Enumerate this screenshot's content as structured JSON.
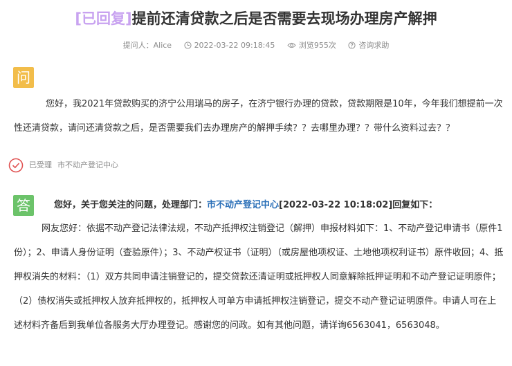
{
  "header": {
    "status": "[已回复]",
    "title": "提前还清贷款之后是否需要去现场办理房产解押"
  },
  "meta": {
    "asker_label": "提问人：",
    "asker": "Alice",
    "time": "2022-03-22 09:18:45",
    "views": "浏览955次",
    "category": "咨询求助"
  },
  "question": {
    "badge": "问",
    "text": "您好，我2021年贷款购买的济宁公用瑞马的房子，在济宁银行办理的贷款，贷款期限是10年，今年我们想提前一次性还清贷款，请问还清贷款之后，是否需要我们去办理房产的解押手续？？去哪里办理？？带什么资料过去？？"
  },
  "status": {
    "accepted": "已受理",
    "department": "市不动产登记中心"
  },
  "answer": {
    "badge": "答",
    "head_prefix": "您好，关于您关注的问题，处理部门：",
    "head_dept": "市不动产登记中心",
    "head_suffix": "[2022-03-22 10:18:02]回复如下：",
    "text": "网友您好：依据不动产登记法律法规，不动产抵押权注销登记（解押）申报材料如下：1、不动产登记申请书（原件1份）；2、申请人身份证明（查验原件）；3、不动产权证书（证明）（或房屋他项权证、土地他项权利证书）原件收回；4、抵押权消失的材料：（1）双方共同申请注销登记的，提交贷款还清证明或抵押权人同意解除抵押证明和不动产登记证明原件；（2）债权消失或抵押权人放弃抵押权的，抵押权人可单方申请抵押权注销登记，提交不动产登记证明原件。申请人可在上述材料齐备后到我单位各服务大厅办理登记。感谢您的问政。如有其他问题，请详询6563041，6563048。"
  },
  "colors": {
    "status_purple": "#c8a2f0",
    "question_badge": "#f2bd4a",
    "answer_badge": "#6cc36a",
    "accepted_red": "#e05252",
    "link_blue": "#2a6fb8"
  },
  "icons": {
    "time": "clock-icon",
    "views": "eye-icon",
    "category": "help-circle-icon",
    "accepted": "check-circle-icon"
  }
}
